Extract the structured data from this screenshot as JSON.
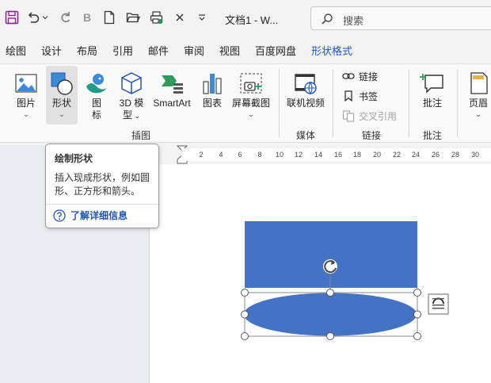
{
  "titlebar": {
    "doc_title": "文档1  -  W...",
    "search_placeholder": "搜索"
  },
  "tabs": [
    "绘图",
    "设计",
    "布局",
    "引用",
    "邮件",
    "审阅",
    "视图",
    "百度网盘",
    "形状格式"
  ],
  "active_tab": "形状格式",
  "ribbon": {
    "insert_group": {
      "label": "插图",
      "picture": "图片",
      "shapes": "形状",
      "icons_line1": "图",
      "icons_line2": "标",
      "model3d_line1": "3D 模",
      "model3d_line2": "型",
      "smartart": "SmartArt",
      "chart": "图表",
      "screenshot": "屏幕截图"
    },
    "media_group": {
      "label": "媒体",
      "online_video": "联机视频"
    },
    "links_group": {
      "label": "链接",
      "link": "链接",
      "bookmark": "书签",
      "cross_ref": "交叉引用"
    },
    "comment_group": {
      "label": "批注",
      "comment": "批注"
    },
    "header_group": {
      "header": "页眉"
    }
  },
  "ruler": {
    "numbers": [
      "2",
      "4",
      "6",
      "8",
      "10",
      "12",
      "14",
      "16",
      "18",
      "20",
      "22",
      "24",
      "26",
      "28",
      "30"
    ]
  },
  "tooltip": {
    "title": "绘制形状",
    "description": "插入现成形状，例如圆形、正方形和箭头。",
    "learn_more": "了解详细信息"
  },
  "colors": {
    "accent": "#1f56b8",
    "shape_fill": "#4472c4"
  }
}
